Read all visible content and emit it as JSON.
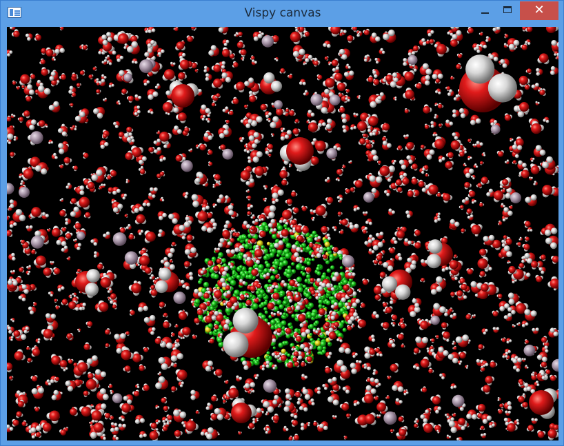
{
  "window": {
    "title": "Vispy canvas",
    "minimize_glyph": "—",
    "maximize_glyph": "□",
    "close_glyph": "✕"
  },
  "canvas": {
    "background": "#000000",
    "scene": "molecular-spheres",
    "colors": {
      "oxygen": "#c4141a",
      "hydrogen": "#e6e6e6",
      "ion": "#b9a6b8",
      "solute_green": "#18c418",
      "solute_yellow": "#e0d21a"
    }
  }
}
